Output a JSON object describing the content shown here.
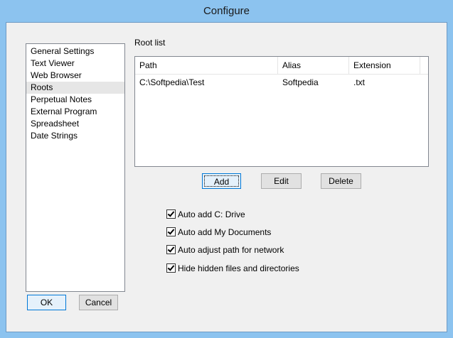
{
  "window": {
    "title": "Configure"
  },
  "sidebar": {
    "items": [
      {
        "label": "General Settings",
        "selected": false
      },
      {
        "label": "Text Viewer",
        "selected": false
      },
      {
        "label": "Web Browser",
        "selected": false
      },
      {
        "label": "Roots",
        "selected": true
      },
      {
        "label": "Perpetual Notes",
        "selected": false
      },
      {
        "label": "External Program",
        "selected": false
      },
      {
        "label": "Spreadsheet",
        "selected": false
      },
      {
        "label": "Date Strings",
        "selected": false
      }
    ]
  },
  "roots": {
    "group_label": "Root list",
    "columns": [
      "Path",
      "Alias",
      "Extension"
    ],
    "rows": [
      {
        "path": "C:\\Softpedia\\Test",
        "alias": "Softpedia",
        "extension": ".txt"
      }
    ],
    "buttons": {
      "add": "Add",
      "edit": "Edit",
      "delete": "Delete"
    },
    "options": [
      {
        "label": "Auto add C: Drive",
        "checked": true
      },
      {
        "label": "Auto add My Documents",
        "checked": true
      },
      {
        "label": "Auto adjust path for network",
        "checked": true
      },
      {
        "label": "Hide hidden files and directories",
        "checked": true
      }
    ]
  },
  "footer": {
    "ok_label": "OK",
    "cancel_label": "Cancel"
  },
  "colors": {
    "titlebar": "#8cc3ef",
    "dialog_bg": "#f0f0f0",
    "selection": "#e6e6e6"
  }
}
